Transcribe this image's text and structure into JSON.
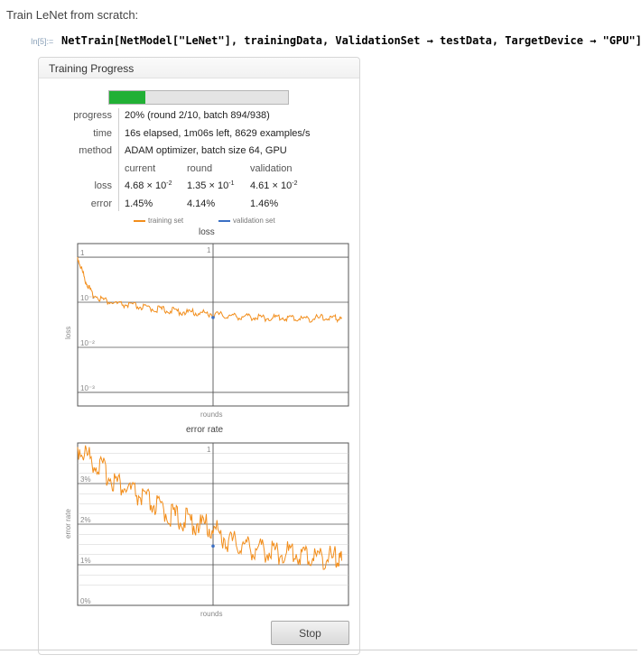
{
  "intro_text": "Train LeNet from scratch:",
  "input": {
    "label": "In[5]:=",
    "code": "NetTrain[NetModel[\"LeNet\"], trainingData, ValidationSet → testData, TargetDevice → \"GPU\"]"
  },
  "panel": {
    "title": "Training Progress",
    "progress_fraction": 0.2,
    "colors": {
      "progress_bar": "#21b035",
      "training_series": "#f28e1c",
      "validation_series": "#3a6fc4"
    },
    "rows": [
      {
        "key": "progress",
        "value": "20% (round 2/10, batch 894/938)"
      },
      {
        "key": "time",
        "value": "16s elapsed, 1m06s left, 8629 examples/s"
      },
      {
        "key": "method",
        "value": "ADAM optimizer, batch size 64, GPU"
      }
    ],
    "table": {
      "headers": [
        "current",
        "round",
        "validation"
      ],
      "rows": [
        {
          "key": "loss",
          "cells": [
            {
              "m": "4.68",
              "e": "-2"
            },
            {
              "m": "1.35",
              "e": "-1"
            },
            {
              "m": "4.61",
              "e": "-2"
            }
          ]
        },
        {
          "key": "error",
          "cells": [
            {
              "t": "1.45%"
            },
            {
              "t": "4.14%"
            },
            {
              "t": "1.46%"
            }
          ]
        }
      ],
      "times_sign": "×",
      "base": "10"
    },
    "legend": {
      "training": "training set",
      "validation": "validation set"
    },
    "stop_label": "Stop"
  },
  "chart_data": [
    {
      "type": "line",
      "title": "loss",
      "xlabel": "rounds",
      "ylabel": "loss",
      "yscale": "log",
      "ylim": [
        0.0005,
        2
      ],
      "xlim": [
        0,
        2
      ],
      "x_tick_labels": [
        "1"
      ],
      "y_tick_labels": [
        "1",
        "10⁻¹",
        "10⁻²",
        "10⁻³"
      ],
      "series": [
        {
          "name": "training set",
          "color": "#f28e1c",
          "x": [
            0,
            0.05,
            0.1,
            0.2,
            0.3,
            0.4,
            0.5,
            0.6,
            0.7,
            0.8,
            0.9,
            1.0,
            1.1,
            1.2,
            1.3,
            1.4,
            1.5,
            1.6,
            1.7,
            1.8,
            1.9,
            1.95
          ],
          "y": [
            1.0,
            0.35,
            0.16,
            0.11,
            0.09,
            0.085,
            0.075,
            0.07,
            0.065,
            0.06,
            0.058,
            0.055,
            0.05,
            0.048,
            0.047,
            0.045,
            0.046,
            0.044,
            0.043,
            0.045,
            0.044,
            0.043
          ]
        },
        {
          "name": "validation set",
          "color": "#3a6fc4",
          "x": [
            1.0
          ],
          "y": [
            0.046
          ]
        }
      ]
    },
    {
      "type": "line",
      "title": "error rate",
      "xlabel": "rounds",
      "ylabel": "error rate",
      "ylim": [
        0,
        4
      ],
      "xlim": [
        0,
        2
      ],
      "x_tick_labels": [
        "1"
      ],
      "y_tick_labels": [
        "0%",
        "1%",
        "2%",
        "3%"
      ],
      "series": [
        {
          "name": "training set",
          "color": "#f28e1c",
          "x": [
            0,
            0.1,
            0.2,
            0.3,
            0.4,
            0.5,
            0.6,
            0.7,
            0.8,
            0.9,
            1.0,
            1.1,
            1.2,
            1.3,
            1.4,
            1.5,
            1.6,
            1.7,
            1.8,
            1.9,
            1.95
          ],
          "y": [
            3.9,
            3.6,
            3.3,
            3.0,
            2.8,
            2.6,
            2.4,
            2.2,
            2.1,
            2.0,
            1.9,
            1.6,
            1.5,
            1.4,
            1.35,
            1.3,
            1.3,
            1.2,
            1.2,
            1.15,
            1.1
          ]
        },
        {
          "name": "validation set",
          "color": "#3a6fc4",
          "x": [
            1.0
          ],
          "y": [
            1.46
          ]
        }
      ]
    }
  ]
}
